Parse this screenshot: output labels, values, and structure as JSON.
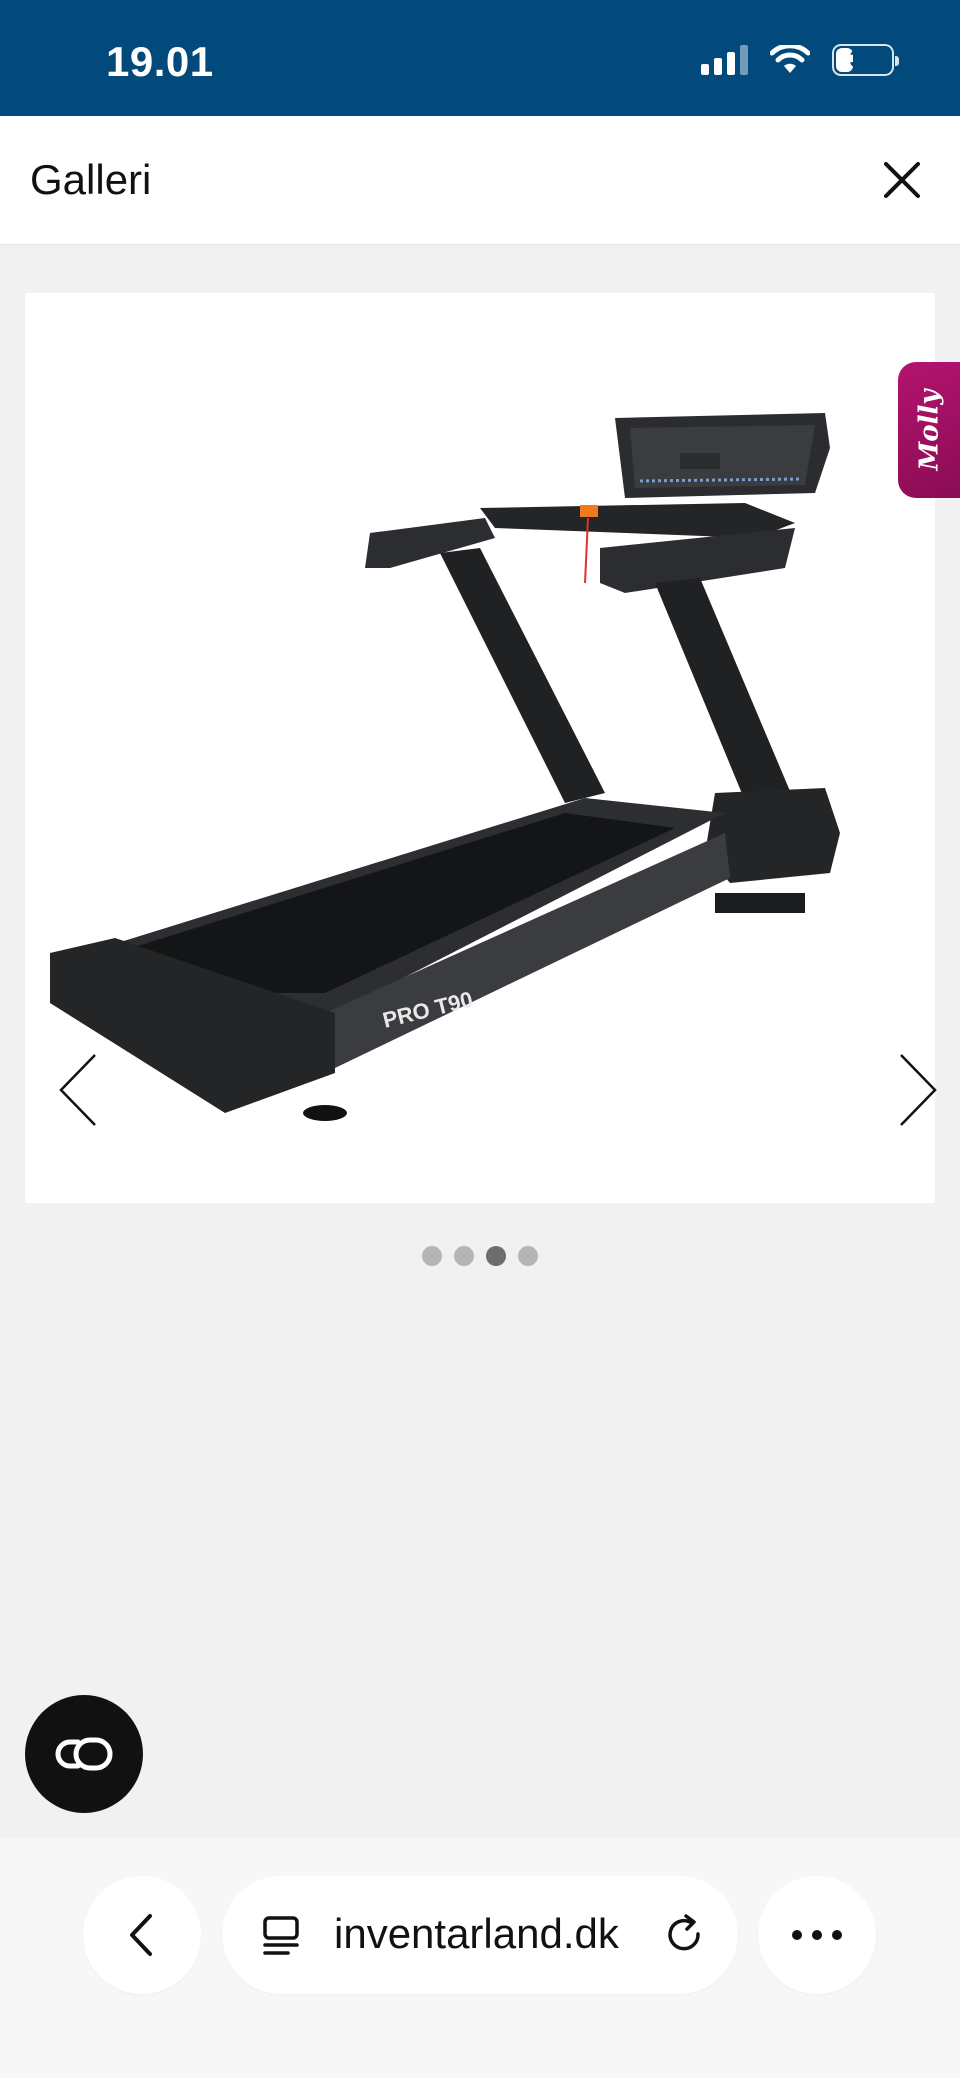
{
  "status_bar": {
    "time": "19.01",
    "battery_level": "31",
    "battery_fraction": 0.31,
    "icons": [
      "cellular-signal-icon",
      "wifi-icon",
      "battery-icon"
    ]
  },
  "header": {
    "title": "Galleri",
    "close_icon": "close-icon"
  },
  "gallery": {
    "image_caption": "PRO T90",
    "prev_icon": "chevron-left-icon",
    "next_icon": "chevron-right-icon",
    "dot_count": 4,
    "active_index": 2
  },
  "molly": {
    "label": "Molly",
    "color": "#a0106a"
  },
  "fab": {
    "icon": "link-icon"
  },
  "browser": {
    "url": "inventarland.dk",
    "back_icon": "chevron-left-icon",
    "page_icon": "page-menu-icon",
    "reload_icon": "reload-icon",
    "more_icon": "more-icon"
  },
  "colors": {
    "status_bar": "#024a7c",
    "background": "#f1f1f1",
    "dot_active": "#6e6e6e",
    "dot_inactive": "#b4b4b4"
  }
}
